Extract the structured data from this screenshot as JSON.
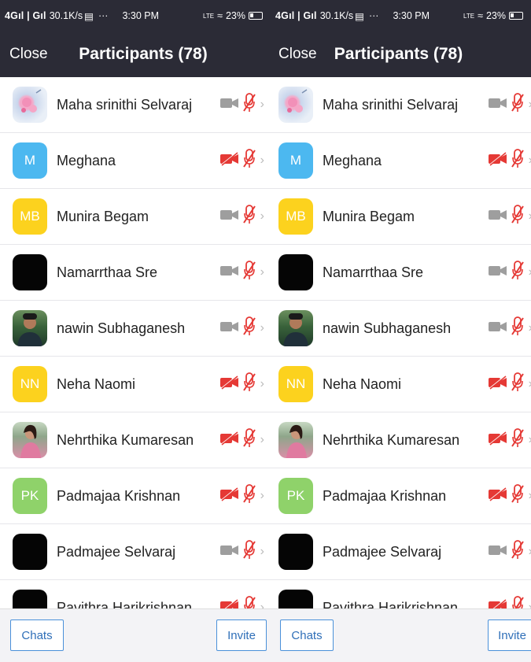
{
  "status_bar": {
    "signal": "4Gıl | Gıl",
    "speed": "30.1K/s",
    "dots": "···",
    "time": "3:30 PM",
    "lte": "LTE",
    "battery": "23%"
  },
  "header": {
    "close_label": "Close",
    "title": "Participants (78)"
  },
  "participants": [
    {
      "name": "Maha srinithi Selvaraj",
      "avatar": "photo-flower",
      "initials": "",
      "video": "off-gray",
      "mic": "muted"
    },
    {
      "name": "Meghana",
      "avatar": "color",
      "initials": "M",
      "color": "#4cb8f0",
      "video": "off-red",
      "mic": "muted"
    },
    {
      "name": "Munira Begam",
      "avatar": "color",
      "initials": "MB",
      "color": "#fcd21e",
      "video": "off-gray",
      "mic": "muted"
    },
    {
      "name": "Namarrthaa Sre",
      "avatar": "photo-black",
      "initials": "",
      "video": "off-gray",
      "mic": "muted"
    },
    {
      "name": "nawin Subhaganesh",
      "avatar": "photo-person",
      "initials": "",
      "video": "off-gray",
      "mic": "muted"
    },
    {
      "name": "Neha Naomi",
      "avatar": "color",
      "initials": "NN",
      "color": "#fcd21e",
      "video": "off-red",
      "mic": "muted"
    },
    {
      "name": "Nehrthika Kumaresan",
      "avatar": "photo-woman",
      "initials": "",
      "video": "off-red",
      "mic": "muted"
    },
    {
      "name": "Padmajaa Krishnan",
      "avatar": "color",
      "initials": "PK",
      "color": "#8fd26a",
      "video": "off-red",
      "mic": "muted"
    },
    {
      "name": "Padmajee Selvaraj",
      "avatar": "photo-black",
      "initials": "",
      "video": "off-gray",
      "mic": "muted"
    },
    {
      "name": "Pavithra Harikrishnan",
      "avatar": "photo-black",
      "initials": "",
      "video": "off-red",
      "mic": "muted"
    }
  ],
  "footer": {
    "chats_label": "Chats",
    "invite_label": "Invite"
  },
  "colors": {
    "header_bg": "#2b2b36",
    "muted_red": "#e53935",
    "video_gray": "#9e9e9e",
    "button_blue": "#2f6fb8"
  },
  "icons": {
    "video": "video-camera-icon",
    "mic": "microphone-muted-icon",
    "chevron": "chevron-right-icon"
  }
}
